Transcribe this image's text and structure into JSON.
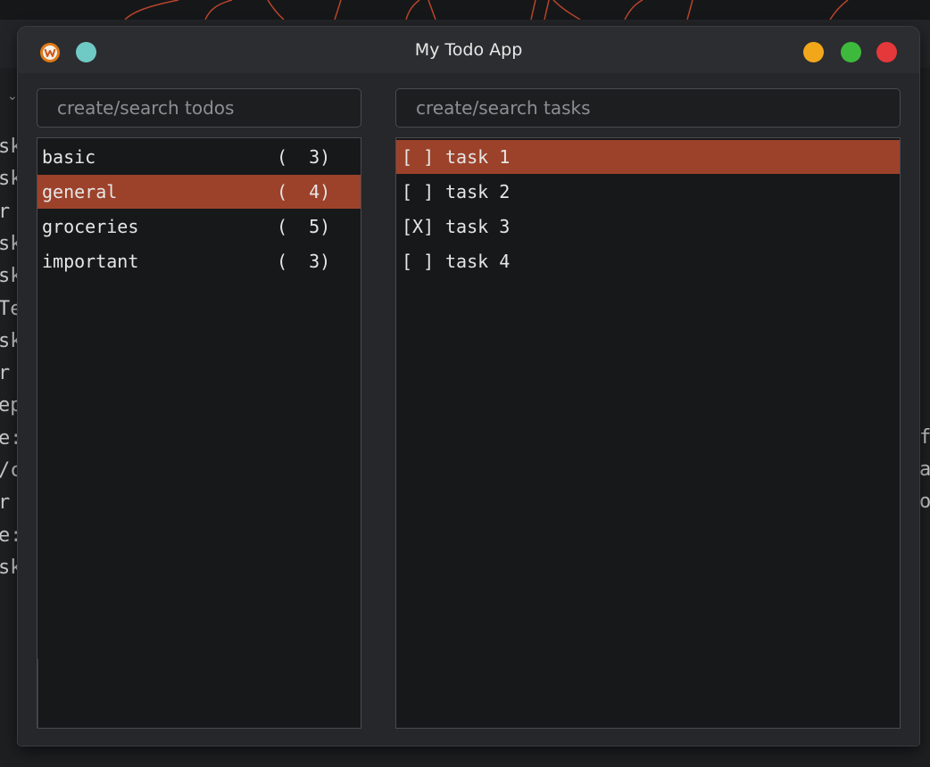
{
  "window": {
    "title": "My Todo App"
  },
  "colors": {
    "accent": "#9c422b",
    "minimize": "#f2a71b",
    "maximize": "#3dba3c",
    "close": "#e5383b",
    "extra": "#6fc9c4"
  },
  "icons": {
    "app": "app-logo-icon",
    "minimize": "minimize-icon",
    "maximize": "maximize-icon",
    "close": "close-icon"
  },
  "todos": {
    "search_placeholder": "create/search todos",
    "items": [
      {
        "name": "basic",
        "count": "(  3)",
        "selected": false
      },
      {
        "name": "general",
        "count": "(  4)",
        "selected": true
      },
      {
        "name": "groceries",
        "count": "(  5)",
        "selected": false
      },
      {
        "name": "important",
        "count": "(  3)",
        "selected": false
      }
    ]
  },
  "tasks": {
    "search_placeholder": "create/search tasks",
    "items": [
      {
        "check": "[ ]",
        "name": "task 1",
        "selected": true
      },
      {
        "check": "[ ]",
        "name": "task 2",
        "selected": false
      },
      {
        "check": "[X]",
        "name": "task 3",
        "selected": false
      },
      {
        "check": "[ ]",
        "name": "task 4",
        "selected": false
      }
    ]
  },
  "background_terminal": {
    "left_fragments": [
      "sk",
      "sk",
      "r",
      "sk",
      "sk",
      "Te",
      "sk",
      "r",
      "ep",
      "e:",
      "/c",
      "r",
      "e:",
      "sk"
    ],
    "right_fragments": [
      "f",
      "a",
      "o"
    ]
  }
}
